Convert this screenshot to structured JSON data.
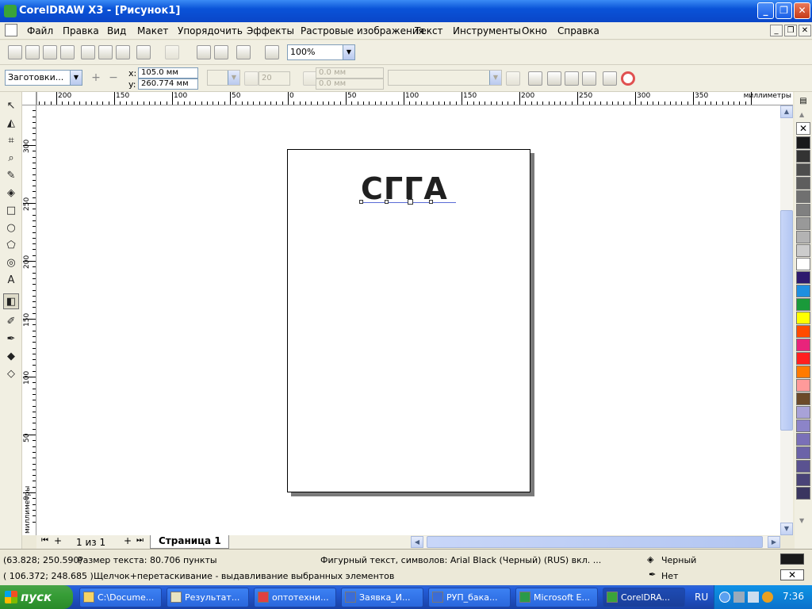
{
  "window": {
    "title": "CorelDRAW X3 - [Рисунок1]"
  },
  "menu": [
    "Файл",
    "Правка",
    "Вид",
    "Макет",
    "Упорядочить",
    "Эффекты",
    "Растровые изображения",
    "Текст",
    "Инструменты",
    "Окно",
    "Справка"
  ],
  "toolbar": {
    "zoom": "100%"
  },
  "property_bar": {
    "preset": "Заготовки...",
    "x_label": "x:",
    "x_value": "105.0 мм",
    "y_label": "y:",
    "y_value": "260.774 мм",
    "steps": "20",
    "offset1": "0.0 мм",
    "offset2": "0.0 мм"
  },
  "ruler": {
    "unit": "миллиметры",
    "h_labels": [
      "200",
      "150",
      "100",
      "50",
      "0",
      "50",
      "100",
      "150",
      "200",
      "250",
      "300",
      "350"
    ],
    "v_labels": [
      "300",
      "250",
      "200",
      "150",
      "100",
      "50",
      "0"
    ]
  },
  "document": {
    "text": "СГГА"
  },
  "pages": {
    "counter": "1 из 1",
    "tab": "Страница 1"
  },
  "status": {
    "coords1": "(63.828; 250.590)",
    "text_size": "Размер текста: 80.706 пункты",
    "object_info": "Фигурный текст, символов: Arial Black (Черный) (RUS) вкл. ...",
    "fill": "Черный",
    "coords2": "( 106.372; 248.685 )",
    "hint": "Щелчок+перетаскивание - выдавливание выбранных элементов",
    "outline": "Нет"
  },
  "palette": [
    "#1a1a1a",
    "#333333",
    "#4d4d4d",
    "#5e5e5e",
    "#707070",
    "#808080",
    "#999999",
    "#b3b3b3",
    "#cccccc",
    "#ffffff",
    "#2e1a6e",
    "#1f8fe0",
    "#1a9a3a",
    "#ffff00",
    "#ff4b00",
    "#e8247b",
    "#ff1f1f",
    "#ff7a00",
    "#ff9a9a",
    "#6b4a2a",
    "#a8a2d8",
    "#8c84c8",
    "#7a70b8",
    "#6b63a8",
    "#5a5290",
    "#4a4478",
    "#3a3660"
  ],
  "taskbar": {
    "start": "пуск",
    "tasks": [
      "C:\\Docume...",
      "Результат...",
      "оптотехни...",
      "Заявка_И...",
      "РУП_бака...",
      "Microsoft E...",
      "CorelDRA..."
    ],
    "lang": "RU",
    "clock": "7:36"
  }
}
